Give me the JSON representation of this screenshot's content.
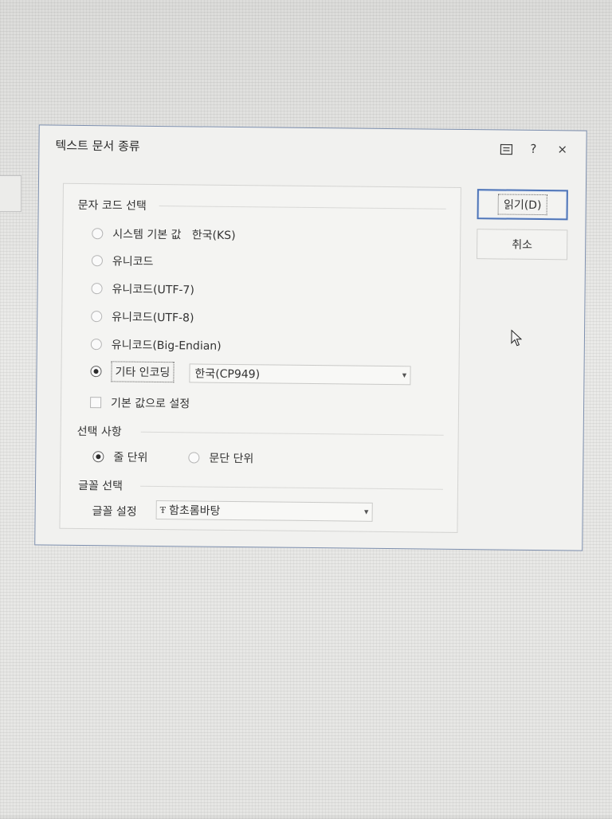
{
  "dialog": {
    "title": "텍스트 문서 종류",
    "titlebar": {
      "menu_icon": "menu-icon",
      "help_label": "?",
      "close_label": "×"
    }
  },
  "encoding": {
    "group_label": "문자 코드 선택",
    "options": [
      {
        "label": "시스템 기본 값   한국(KS)",
        "checked": false
      },
      {
        "label": "유니코드",
        "checked": false
      },
      {
        "label": "유니코드(UTF-7)",
        "checked": false
      },
      {
        "label": "유니코드(UTF-8)",
        "checked": false
      },
      {
        "label": "유니코드(Big-Endian)",
        "checked": false
      },
      {
        "label": "기타 인코딩",
        "checked": true
      }
    ],
    "other_select_value": "한국(CP949)",
    "default_checkbox_label": "기본 값으로 설정",
    "default_checkbox_checked": false
  },
  "options": {
    "group_label": "선택 사항",
    "line_unit_label": "줄 단위",
    "line_unit_checked": true,
    "paragraph_unit_label": "문단 단위",
    "paragraph_unit_checked": false
  },
  "font": {
    "group_label": "글꼴 선택",
    "setting_label": "글꼴 설정",
    "font_icon": "truetype-font-icon",
    "value": "함초롬바탕"
  },
  "buttons": {
    "read_label": "읽기(D)",
    "cancel_label": "취소"
  },
  "colors": {
    "accent": "#4d74b8",
    "dialog_border": "#7d8fae"
  }
}
